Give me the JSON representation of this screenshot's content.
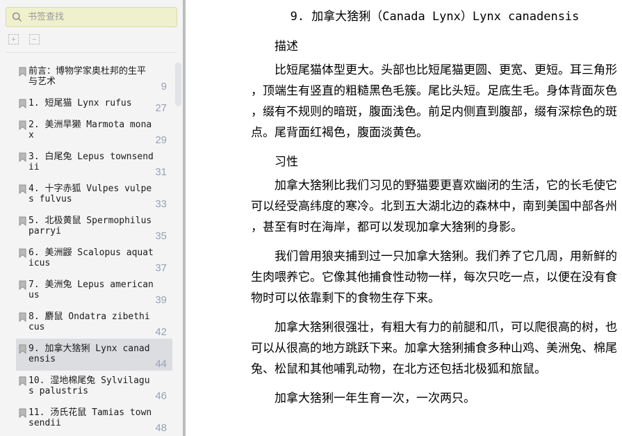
{
  "sidebar": {
    "search": {
      "placeholder": "书签查找"
    },
    "toolbar": {
      "expand_all_label": "+",
      "collapse_all_label": "−"
    },
    "bookmarks": [
      {
        "label": "前言：博物学家奥杜邦的生平与艺术",
        "page": "9",
        "selected": false
      },
      {
        "label": "1. 短尾猫 Lynx rufus",
        "page": "27",
        "selected": false
      },
      {
        "label": "2. 美洲旱獭 Marmota monax",
        "page": "29",
        "selected": false
      },
      {
        "label": "3. 白尾兔 Lepus townsendii",
        "page": "31",
        "selected": false
      },
      {
        "label": "4. 十字赤狐 Vulpes vulpes fulvus",
        "page": "33",
        "selected": false
      },
      {
        "label": "5. 北极黄鼠 Spermophilus parryi",
        "page": "35",
        "selected": false
      },
      {
        "label": "6. 美洲鼹 Scalopus aquaticus",
        "page": "37",
        "selected": false
      },
      {
        "label": "7. 美洲兔 Lepus americanus",
        "page": "39",
        "selected": false
      },
      {
        "label": "8. 麝鼠 Ondatra zibethicus",
        "page": "42",
        "selected": false
      },
      {
        "label": "9. 加拿大猞猁 Lynx canadensis",
        "page": "44",
        "selected": true
      },
      {
        "label": "10. 湿地棉尾兔 Sylvilagus palustris",
        "page": "46",
        "selected": false
      },
      {
        "label": "11. 汤氏花鼠 Tamias townsendii",
        "page": "48",
        "selected": false
      }
    ]
  },
  "document": {
    "title": "9. 加拿大猞猁（Canada Lynx）Lynx canadensis",
    "sections": [
      {
        "heading": "描述",
        "paragraphs": [
          "比短尾猫体型更大。头部也比短尾猫更圆、更宽、更短。耳三角形，顶端生有竖直的粗糙黑色毛簇。尾比头短。足底生毛。身体背面灰色，缀有不规则的暗斑，腹面浅色。前足内侧直到腹部，缀有深棕色的斑点。尾背面红褐色，腹面淡黄色。"
        ]
      },
      {
        "heading": "习性",
        "paragraphs": [
          "加拿大猞猁比我们习见的野猫要更喜欢幽闭的生活，它的长毛使它可以经受高纬度的寒冷。北到五大湖北边的森林中，南到美国中部各州，甚至有时在海岸，都可以发现加拿大猞猁的身影。",
          "我们曾用狼夹捕到过一只加拿大猞猁。我们养了它几周，用新鲜的生肉喂养它。它像其他捕食性动物一样，每次只吃一点，以便在没有食物时可以依靠剩下的食物生存下来。",
          "加拿大猞猁很强壮，有粗大有力的前腿和爪，可以爬很高的树，也可以从很高的地方跳跃下来。加拿大猞猁捕食多种山鸡、美洲兔、棉尾兔、松鼠和其他哺乳动物，在北方还包括北极狐和旅鼠。",
          "加拿大猞猁一年生育一次，一次两只。"
        ]
      }
    ]
  },
  "colors": {
    "sidebar_bg": "#f4f4f5",
    "search_box_bg": "#eff1cc",
    "search_box_border": "#d9dba5",
    "selected_item_bg": "#dcdde1",
    "page_number_text": "#9aa1b3",
    "pane_divider": "#bbbcc0",
    "content_bg": "#ffffff"
  }
}
